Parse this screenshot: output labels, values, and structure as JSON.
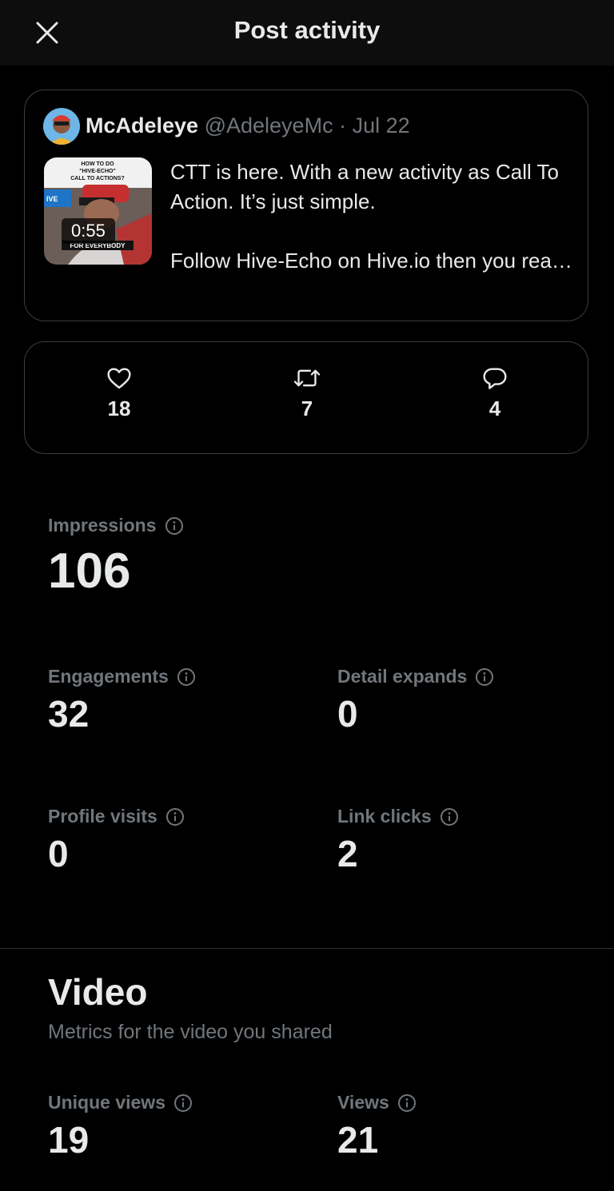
{
  "header": {
    "title": "Post activity",
    "close_icon": "close-icon"
  },
  "post": {
    "author_name": "McAdeleye",
    "author_handle": "@AdeleyeMc",
    "date": "Jul 22",
    "separator": " · ",
    "video_duration": "0:55",
    "thumbnail_text": {
      "top_lines": [
        "HOW TO DO",
        "\"HIVE-ECHO\"",
        "CALL TO ACTIONS?"
      ],
      "side": "IVE",
      "bottom": "FOR EVERYBODY"
    },
    "text_paragraph_1": "CTT is here. With a new activity as Call To Action. It’s just simple.",
    "text_paragraph_2": "Follow Hive-Echo on Hive.io then you read the details carefully to participat..."
  },
  "stats": [
    {
      "icon": "heart-icon",
      "count": "18"
    },
    {
      "icon": "repost-icon",
      "count": "7"
    },
    {
      "icon": "reply-icon",
      "count": "4"
    }
  ],
  "metrics": {
    "impressions": {
      "label": "Impressions",
      "value": "106"
    },
    "engagements": {
      "label": "Engagements",
      "value": "32"
    },
    "detail_expands": {
      "label": "Detail expands",
      "value": "0"
    },
    "profile_visits": {
      "label": "Profile visits",
      "value": "0"
    },
    "link_clicks": {
      "label": "Link clicks",
      "value": "2"
    }
  },
  "video": {
    "title": "Video",
    "subtitle": "Metrics for the video you shared",
    "unique_views": {
      "label": "Unique views",
      "value": "19"
    },
    "views": {
      "label": "Views",
      "value": "21"
    }
  },
  "colors": {
    "background": "#000000",
    "header": "#0d0d0d",
    "text": "#e7e9ea",
    "muted": "#71767b",
    "border": "#3a3d41"
  }
}
